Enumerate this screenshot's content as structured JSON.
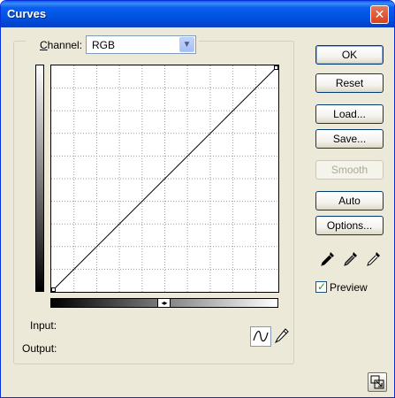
{
  "window": {
    "title": "Curves",
    "close_symbol": "✕"
  },
  "channel": {
    "label_prefix": "",
    "label_underlined": "C",
    "label_rest": "hannel:",
    "selected": "RGB",
    "arrow_symbol": "▼"
  },
  "curve_range_toggle": "◂▸",
  "labels": {
    "input": "Input:",
    "output": "Output:"
  },
  "buttons": {
    "ok": "OK",
    "reset": "Reset",
    "load": "Load...",
    "save": "Save...",
    "smooth": "Smooth",
    "auto": "Auto",
    "options": "Options..."
  },
  "preview": {
    "label": "Preview",
    "checked": true,
    "check_symbol": "✓"
  },
  "icons": {
    "eyedroppers": [
      "black-point-eyedropper-icon",
      "gray-point-eyedropper-icon",
      "white-point-eyedropper-icon"
    ],
    "curve_tool": "curve-tool-icon",
    "pencil_tool": "pencil-tool-icon",
    "resize": "expand-grid-icon"
  },
  "colors": {
    "title_bar": "#0053e1",
    "dialog_bg": "#ece9d8",
    "check_green": "#21a121"
  }
}
